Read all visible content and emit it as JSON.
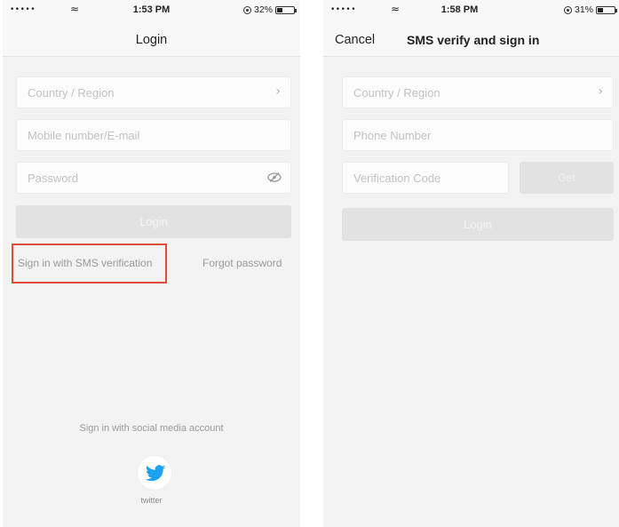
{
  "left_screen": {
    "status": {
      "signal": "•••••",
      "time": "1:53 PM",
      "battery_percent": "32%",
      "battery_level": 0.32
    },
    "title": "Login",
    "country_placeholder": "Country / Region",
    "account_placeholder": "Mobile number/E-mail",
    "password_placeholder": "Password",
    "login_label": "Login",
    "sms_link": "Sign in with SMS verification",
    "forgot_link": "Forgot password",
    "social_title": "Sign in with social media account",
    "twitter_label": "twitter"
  },
  "right_screen": {
    "status": {
      "signal": "•••••",
      "time": "1:58 PM",
      "battery_percent": "31%",
      "battery_level": 0.31
    },
    "cancel_label": "Cancel",
    "title": "SMS verify and sign in",
    "country_placeholder": "Country / Region",
    "phone_placeholder": "Phone Number",
    "code_placeholder": "Verification Code",
    "get_label": "Get",
    "login_label": "Login"
  },
  "colors": {
    "highlight_border": "#e24a3b",
    "twitter_blue": "#1da1f2",
    "disabled_button": "#e2e2e2"
  },
  "icons": [
    "wifi-icon",
    "chevron-right-icon",
    "eye-slash-icon",
    "twitter-icon",
    "battery-icon",
    "orientation-lock-icon"
  ]
}
